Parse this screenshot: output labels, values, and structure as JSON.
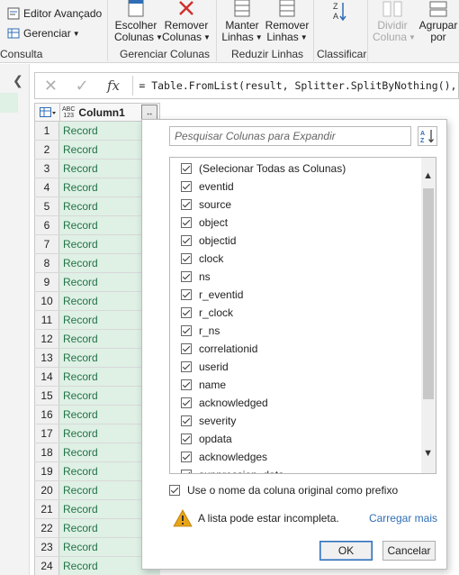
{
  "ribbon": {
    "editor_avancado": "Editor Avançado",
    "gerenciar": "Gerenciar",
    "consulta_label": "Consulta",
    "escolher": [
      "Escolher",
      "Colunas"
    ],
    "remover_colunas": [
      "Remover",
      "Colunas"
    ],
    "gerenciar_colunas_label": "Gerenciar Colunas",
    "manter": [
      "Manter",
      "Linhas"
    ],
    "remover_linhas": [
      "Remover",
      "Linhas"
    ],
    "reduzir_linhas_label": "Reduzir Linhas",
    "classificar_label": "Classificar",
    "dividir": [
      "Dividir",
      "Coluna"
    ],
    "agrupar": [
      "Agrupar",
      "por"
    ]
  },
  "formula": {
    "text": "= Table.FromList(result, Splitter.SplitByNothing(), n"
  },
  "grid": {
    "type_label_top": "ABC",
    "type_label_bottom": "123",
    "column_header": "Column1",
    "rows": [
      {
        "num": "1",
        "value": "Record"
      },
      {
        "num": "2",
        "value": "Record"
      },
      {
        "num": "3",
        "value": "Record"
      },
      {
        "num": "4",
        "value": "Record"
      },
      {
        "num": "5",
        "value": "Record"
      },
      {
        "num": "6",
        "value": "Record"
      },
      {
        "num": "7",
        "value": "Record"
      },
      {
        "num": "8",
        "value": "Record"
      },
      {
        "num": "9",
        "value": "Record"
      },
      {
        "num": "10",
        "value": "Record"
      },
      {
        "num": "11",
        "value": "Record"
      },
      {
        "num": "12",
        "value": "Record"
      },
      {
        "num": "13",
        "value": "Record"
      },
      {
        "num": "14",
        "value": "Record"
      },
      {
        "num": "15",
        "value": "Record"
      },
      {
        "num": "16",
        "value": "Record"
      },
      {
        "num": "17",
        "value": "Record"
      },
      {
        "num": "18",
        "value": "Record"
      },
      {
        "num": "19",
        "value": "Record"
      },
      {
        "num": "20",
        "value": "Record"
      },
      {
        "num": "21",
        "value": "Record"
      },
      {
        "num": "22",
        "value": "Record"
      },
      {
        "num": "23",
        "value": "Record"
      },
      {
        "num": "24",
        "value": "Record"
      }
    ]
  },
  "panel": {
    "search_placeholder": "Pesquisar Colunas para Expandir",
    "columns": [
      {
        "label": "(Selecionar Todas as Colunas)",
        "checked": true
      },
      {
        "label": "eventid",
        "checked": true
      },
      {
        "label": "source",
        "checked": true
      },
      {
        "label": "object",
        "checked": true
      },
      {
        "label": "objectid",
        "checked": true
      },
      {
        "label": "clock",
        "checked": true
      },
      {
        "label": "ns",
        "checked": true
      },
      {
        "label": "r_eventid",
        "checked": true
      },
      {
        "label": "r_clock",
        "checked": true
      },
      {
        "label": "r_ns",
        "checked": true
      },
      {
        "label": "correlationid",
        "checked": true
      },
      {
        "label": "userid",
        "checked": true
      },
      {
        "label": "name",
        "checked": true
      },
      {
        "label": "acknowledged",
        "checked": true
      },
      {
        "label": "severity",
        "checked": true
      },
      {
        "label": "opdata",
        "checked": true
      },
      {
        "label": "acknowledges",
        "checked": true
      },
      {
        "label": "suppression_data",
        "checked": true
      }
    ],
    "prefix_label": "Use o nome da coluna original como prefixo",
    "prefix_checked": true,
    "warning_text": "A lista pode estar incompleta.",
    "load_more": "Carregar mais",
    "ok": "OK",
    "cancel": "Cancelar"
  },
  "colors": {
    "accent": "#2f6db5",
    "record_green": "#217346",
    "record_bg": "#dff0e5",
    "warning": "#e8a317"
  }
}
